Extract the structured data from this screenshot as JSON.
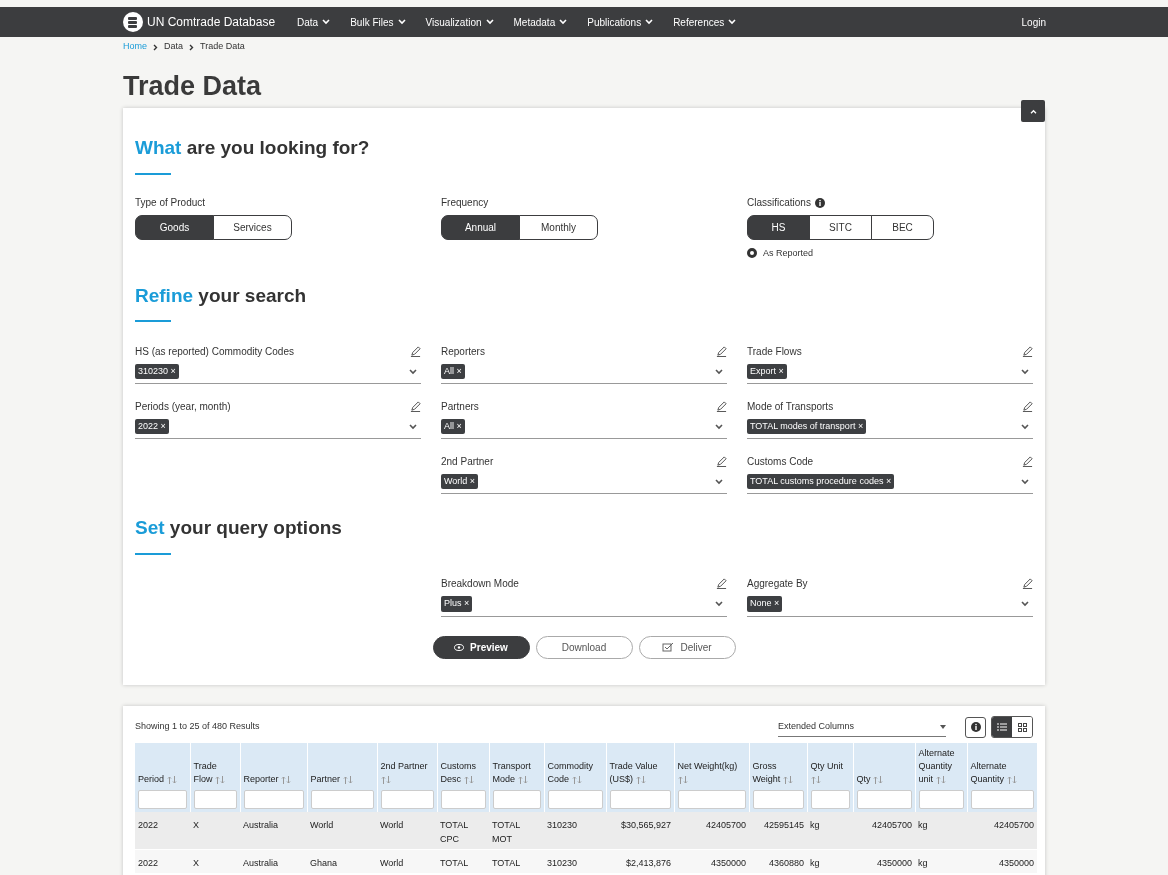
{
  "nav": {
    "brand": "UN Comtrade Database",
    "menus": [
      "Data",
      "Bulk Files",
      "Visualization",
      "Metadata",
      "Publications",
      "References"
    ],
    "login": "Login"
  },
  "breadcrumb": [
    {
      "label": "Home",
      "link": true
    },
    {
      "label": "Data",
      "link": false
    },
    {
      "label": "Trade Data",
      "link": false
    }
  ],
  "title": "Trade Data",
  "what": {
    "heading_accent": "What",
    "heading_rest": "are you looking for?",
    "groups": [
      {
        "label": "Type of Product",
        "options": [
          {
            "label": "Goods",
            "selected": true
          },
          {
            "label": "Services",
            "selected": false
          }
        ]
      },
      {
        "label": "Frequency",
        "options": [
          {
            "label": "Annual",
            "selected": true
          },
          {
            "label": "Monthly",
            "selected": false
          }
        ]
      },
      {
        "label": "Classifications",
        "info": true,
        "options": [
          {
            "label": "HS",
            "selected": true
          },
          {
            "label": "SITC",
            "selected": false
          },
          {
            "label": "BEC",
            "selected": false
          }
        ],
        "radio": {
          "label": "As Reported",
          "checked": true
        }
      }
    ]
  },
  "refine": {
    "heading_accent": "Refine",
    "heading_rest": "your search",
    "columns": [
      [
        {
          "label": "HS (as reported) Commodity Codes",
          "tags": [
            {
              "label": "310230",
              "remove": "×"
            }
          ]
        },
        {
          "label": "Periods (year, month)",
          "tags": [
            {
              "label": "2022",
              "remove": "×"
            }
          ]
        }
      ],
      [
        {
          "label": "Reporters",
          "tags": [
            {
              "label": "All",
              "remove": "×"
            }
          ]
        },
        {
          "label": "Partners",
          "tags": [
            {
              "label": "All",
              "remove": "×"
            }
          ]
        },
        {
          "label": "2nd Partner",
          "tags": [
            {
              "label": "World",
              "remove": "×"
            }
          ]
        }
      ],
      [
        {
          "label": "Trade Flows",
          "tags": [
            {
              "label": "Export",
              "remove": "×"
            }
          ]
        },
        {
          "label": "Mode of Transports",
          "tags": [
            {
              "label": "TOTAL modes of transport",
              "remove": "×"
            }
          ]
        },
        {
          "label": "Customs Code",
          "tags": [
            {
              "label": "TOTAL customs procedure codes",
              "remove": "×"
            }
          ]
        }
      ]
    ]
  },
  "query": {
    "heading_accent": "Set",
    "heading_rest": "your query options",
    "fields": [
      {
        "label": "Breakdown Mode",
        "tags": [
          {
            "label": "Plus",
            "remove": "×"
          }
        ]
      },
      {
        "label": "Aggregate By",
        "tags": [
          {
            "label": "None",
            "remove": "×"
          }
        ]
      }
    ]
  },
  "actions": [
    {
      "label": "Preview",
      "kind": "primary"
    },
    {
      "label": "Download",
      "kind": "plain"
    },
    {
      "label": "Deliver",
      "kind": "deliver"
    }
  ],
  "results": {
    "summary": "Showing 1 to 25 of 480 Results",
    "columns_select": "Extended Columns",
    "view": [
      {
        "kind": "list",
        "selected": true
      },
      {
        "kind": "grid",
        "selected": false
      }
    ],
    "table": {
      "columns": [
        {
          "label": "Period"
        },
        {
          "label": "Trade Flow"
        },
        {
          "label": "Reporter"
        },
        {
          "label": "Partner"
        },
        {
          "label": "2nd Partner"
        },
        {
          "label": "Customs Desc"
        },
        {
          "label": "Transport Mode"
        },
        {
          "label": "Commodity Code"
        },
        {
          "label": "Trade Value (US$)"
        },
        {
          "label": "Net Weight(kg)"
        },
        {
          "label": "Gross Weight"
        },
        {
          "label": "Qty Unit"
        },
        {
          "label": "Qty"
        },
        {
          "label": "Alternate Quantity unit"
        },
        {
          "label": "Alternate Quantity"
        }
      ],
      "rows": [
        [
          "2022",
          "X",
          "Australia",
          "World",
          "World",
          "TOTAL CPC",
          "TOTAL MOT",
          "310230",
          "$30,565,927",
          "42405700",
          "42595145",
          "kg",
          "42405700",
          "kg",
          "42405700"
        ],
        [
          "2022",
          "X",
          "Australia",
          "Ghana",
          "World",
          "TOTAL",
          "TOTAL",
          "310230",
          "$2,413,876",
          "4350000",
          "4360880",
          "kg",
          "4350000",
          "kg",
          "4350000"
        ]
      ]
    }
  }
}
